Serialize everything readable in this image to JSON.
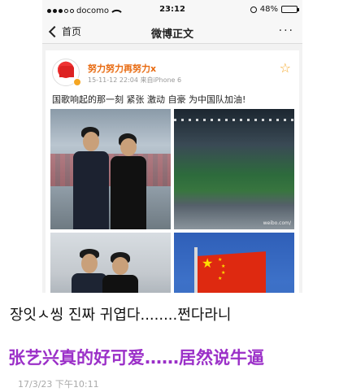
{
  "status_bar": {
    "carrier": "docomo",
    "time": "23:12",
    "battery": "48%",
    "battery_level": 0.48
  },
  "nav": {
    "back_label": "首页",
    "title": "微博正文",
    "more": "···"
  },
  "post": {
    "username": "努力努力再努力x",
    "meta": "15-11-12 22:04  来自iPhone 6",
    "text": "国歌响起的那一刻 紧张 激动 自豪 为中国队加油!",
    "watermark": "weibo.com/"
  },
  "overlay": {
    "korean_caption": "장잇ㅅ씽 진짜 귀엽다........쩐다라니",
    "chinese_caption": "张艺兴真的好可爱……居然说牛逼",
    "timestamp": "17/3/23 下午10:11"
  },
  "colors": {
    "username": "#e86a10",
    "caption_purple": "#9b30c8",
    "flag_red": "#de2910"
  }
}
